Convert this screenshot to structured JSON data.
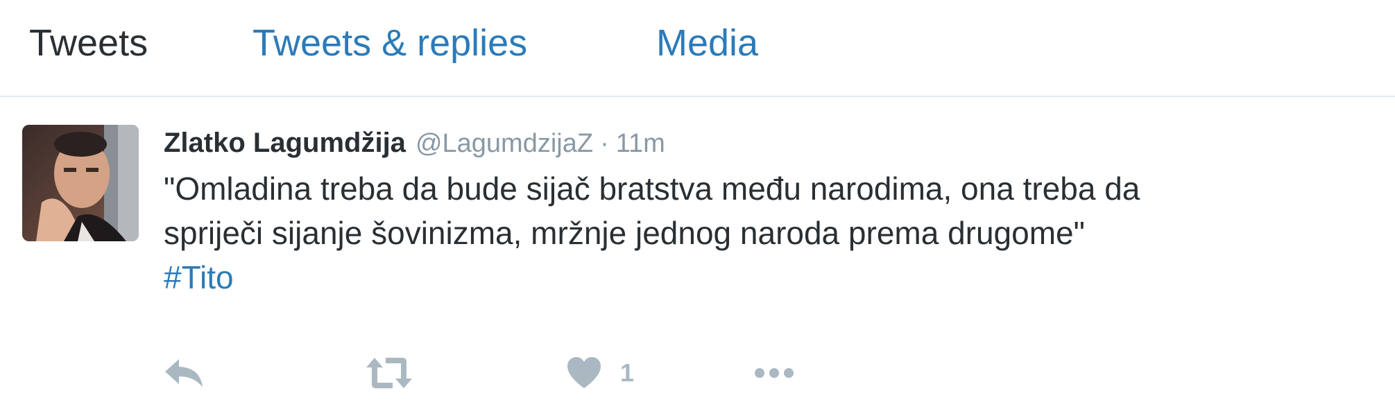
{
  "tabs": [
    {
      "label": "Tweets",
      "active": true
    },
    {
      "label": "Tweets & replies",
      "active": false
    },
    {
      "label": "Media",
      "active": false
    }
  ],
  "tweet": {
    "fullname": "Zlatko Lagumdžija",
    "username": "@LagumdzijaZ",
    "separator": "·",
    "timestamp": "11m",
    "text_lines": [
      "\"Omladina treba da bude sijač bratstva među narodima, ona treba da",
      "spriječi sijanje šovinizma, mržnje jednog naroda prema drugome\""
    ],
    "hashtag": "#Tito",
    "actions": {
      "reply_icon": "reply-icon",
      "retweet_icon": "retweet-icon",
      "like_icon": "heart-icon",
      "like_count": "1",
      "more_icon": "more-dots-icon"
    }
  },
  "colors": {
    "link": "#2b7bb9",
    "text": "#292f33",
    "muted": "#8899a6",
    "icon": "#aab8c2",
    "divider": "#e1e8ed"
  }
}
